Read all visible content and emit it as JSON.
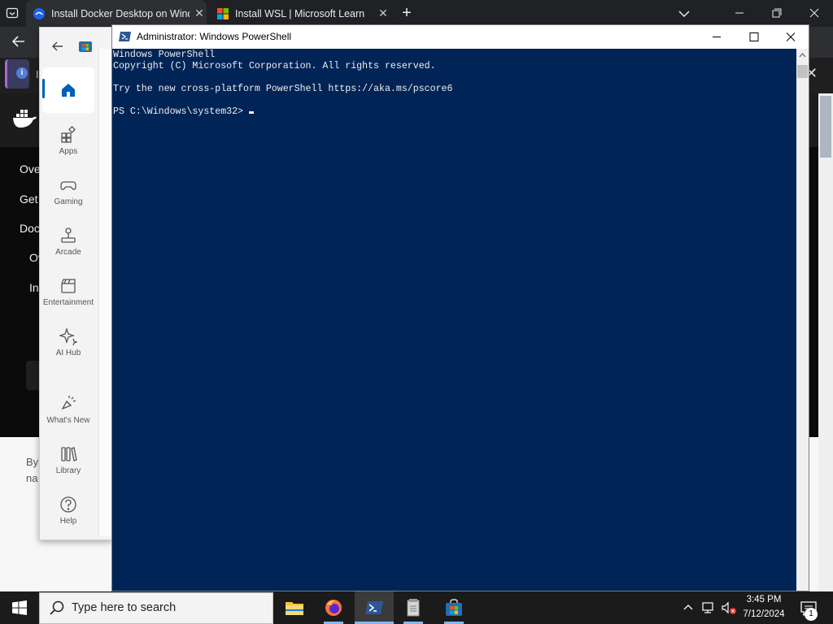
{
  "browser": {
    "tabs": [
      {
        "title": "Install Docker Desktop on Windo",
        "active": true,
        "icon": "docker-docs-icon"
      },
      {
        "title": "Install WSL | Microsoft Learn",
        "active": false,
        "icon": "microsoft-icon"
      }
    ],
    "new_tab_label": "+",
    "close_glyph": "✕"
  },
  "background_page": {
    "notification_text": "I",
    "notification_close": "✕",
    "sidebar_items": [
      "Ove",
      "Get",
      "Doc",
      "Ov",
      "In"
    ],
    "footer_lines": [
      "By",
      "na"
    ]
  },
  "store": {
    "nav": [
      {
        "label": "Apps",
        "icon": "apps-icon"
      },
      {
        "label": "Gaming",
        "icon": "gamepad-icon"
      },
      {
        "label": "Arcade",
        "icon": "joystick-icon"
      },
      {
        "label": "Entertainment",
        "icon": "clapperboard-icon"
      },
      {
        "label": "AI Hub",
        "icon": "sparkle-icon"
      },
      {
        "label": "What's New",
        "icon": "megaphone-icon"
      },
      {
        "label": "Library",
        "icon": "library-icon"
      },
      {
        "label": "Help",
        "icon": "help-icon"
      }
    ]
  },
  "powershell": {
    "title": "Administrator: Windows PowerShell",
    "lines": [
      "Windows PowerShell",
      "Copyright (C) Microsoft Corporation. All rights reserved.",
      "",
      "Try the new cross-platform PowerShell https://aka.ms/pscore6",
      ""
    ],
    "prompt": "PS C:\\Windows\\system32> ",
    "background_color": "#012456",
    "text_color": "#eeedf0"
  },
  "taskbar": {
    "search_placeholder": "Type here to search",
    "apps": [
      "file-explorer-icon",
      "firefox-icon",
      "powershell-icon",
      "notepad-icon",
      "microsoft-store-icon"
    ],
    "clock_time": "3:45 PM",
    "clock_date": "7/12/2024",
    "notification_count": "1"
  }
}
